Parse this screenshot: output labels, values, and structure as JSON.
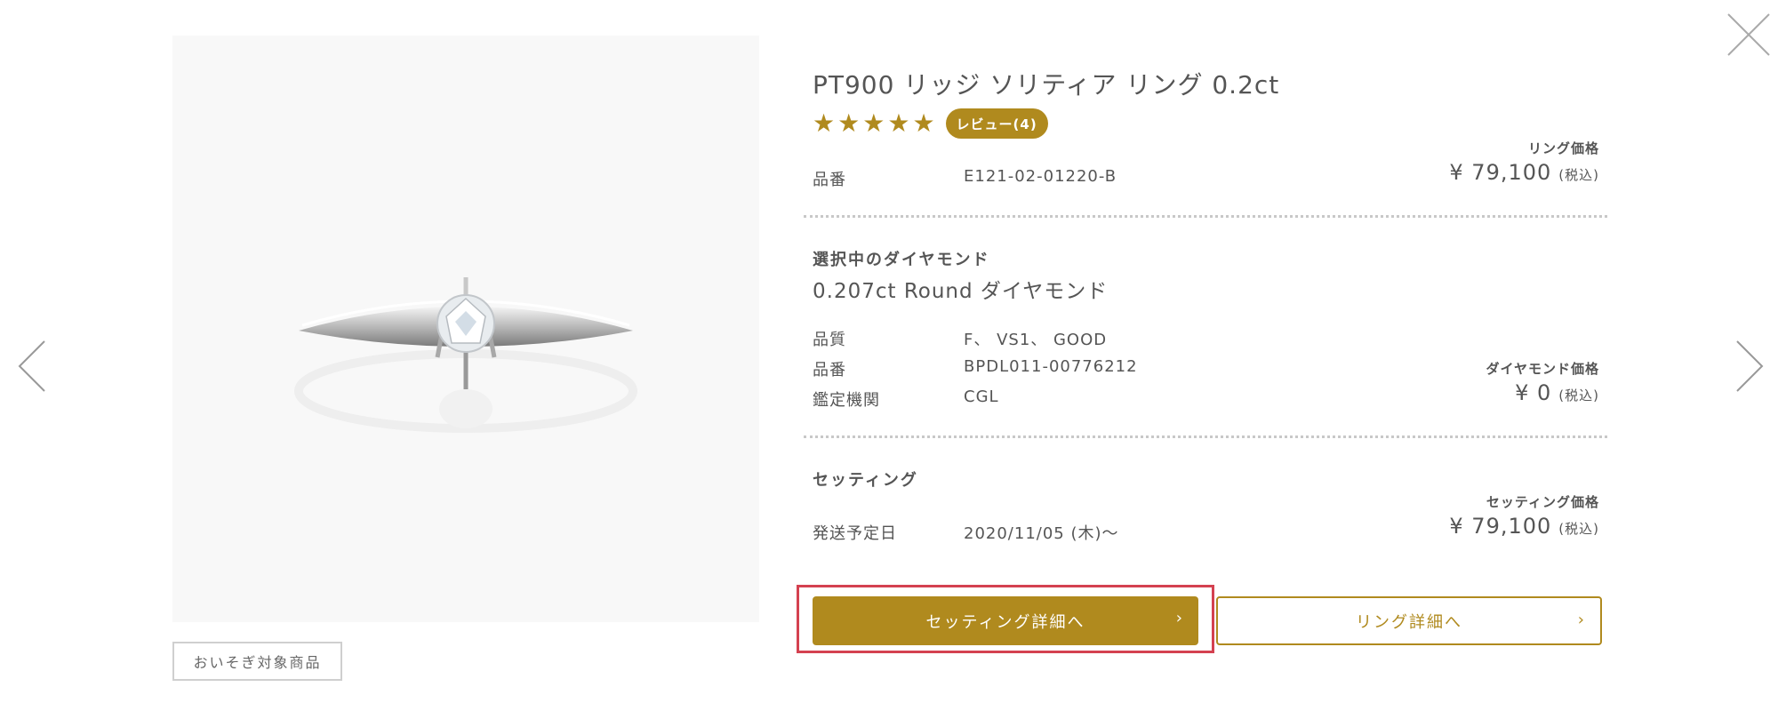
{
  "product": {
    "title": "PT900 リッジ ソリティア リング 0.2ct",
    "rating_stars": 5,
    "review_badge": "レビュー(4)",
    "code_label": "品番",
    "code_value": "E121-02-01220-B",
    "ring_price_label": "リング価格",
    "ring_price": "¥ 79,100",
    "tax_note": "(税込)"
  },
  "diamond": {
    "section_title": "選択中のダイヤモンド",
    "name": "0.207ct Round ダイヤモンド",
    "quality_label": "品質",
    "quality_value": "F、 VS1、 GOOD",
    "code_label": "品番",
    "code_value": "BPDL011-00776212",
    "lab_label": "鑑定機関",
    "lab_value": "CGL",
    "price_label": "ダイヤモンド価格",
    "price": "¥ 0",
    "tax_note": "(税込)"
  },
  "setting": {
    "section_title": "セッティング",
    "ship_label": "発送予定日",
    "ship_value": "2020/11/05 (木)〜",
    "price_label": "セッティング価格",
    "price": "¥ 79,100",
    "tax_note": "(税込)"
  },
  "buttons": {
    "primary": "セッティング詳細へ",
    "secondary": "リング詳細へ",
    "chevron": "›"
  },
  "badge": {
    "express": "おいそぎ対象商品"
  },
  "colors": {
    "accent": "#b08a1e",
    "highlight": "#d44150"
  },
  "icons": {
    "close": "close-icon",
    "prev": "chevron-left-icon",
    "next": "chevron-right-icon",
    "star": "star-icon"
  }
}
